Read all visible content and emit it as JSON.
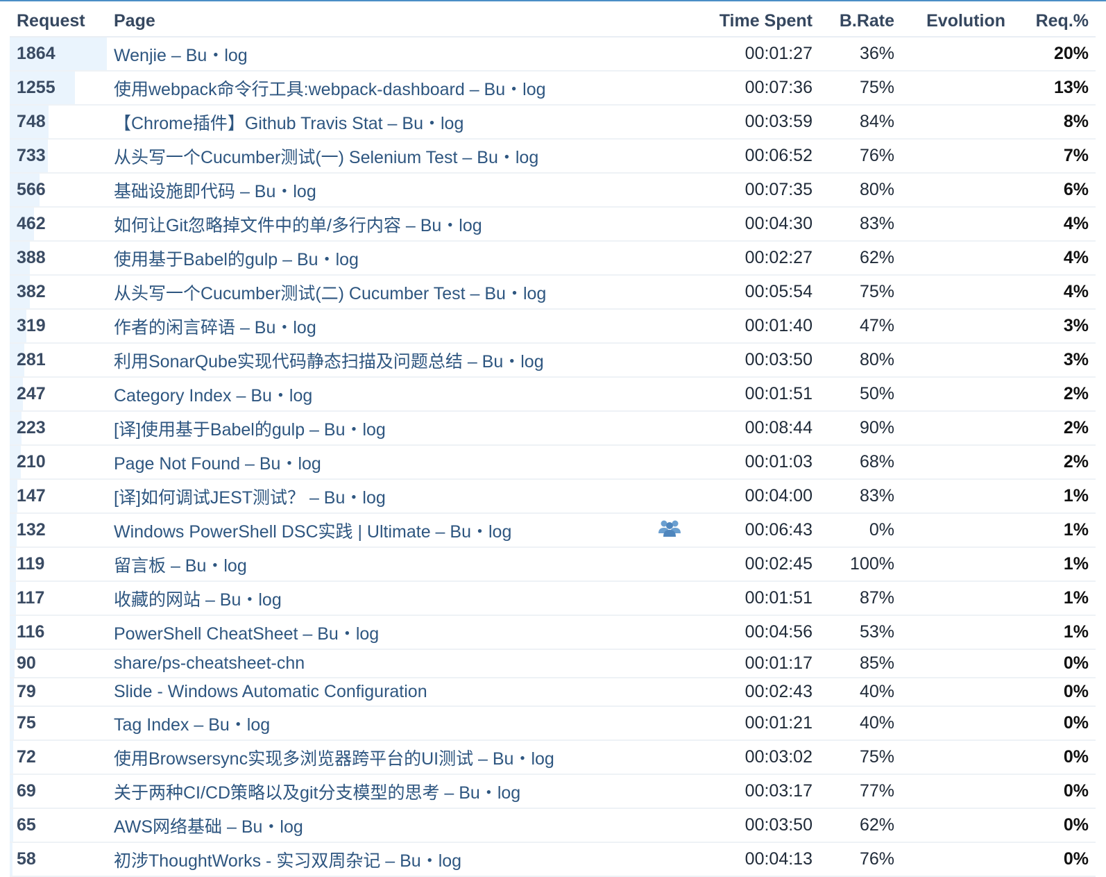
{
  "table": {
    "headers": {
      "request": "Request",
      "page": "Page",
      "time_spent": "Time Spent",
      "bounce_rate": "B.Rate",
      "evolution": "Evolution",
      "req_pct": "Req.%"
    },
    "colors": {
      "accent": "#4a8ec6",
      "request_bar": "#eaf4fd",
      "link": "#2e5680",
      "icon": "#6a9fd0"
    },
    "rows": [
      {
        "request": "1864",
        "bar_fraction": 1.0,
        "page": "Wenjie – Bu・log",
        "time": "00:01:27",
        "brate": "36%",
        "evolution": "",
        "req_pct": "20%"
      },
      {
        "request": "1255",
        "bar_fraction": 0.673,
        "page": "使用webpack命令行工具:webpack-dashboard – Bu・log",
        "time": "00:07:36",
        "brate": "75%",
        "evolution": "",
        "req_pct": "13%"
      },
      {
        "request": "748",
        "bar_fraction": 0.401,
        "page": "【Chrome插件】Github Travis Stat – Bu・log",
        "time": "00:03:59",
        "brate": "84%",
        "evolution": "",
        "req_pct": "8%"
      },
      {
        "request": "733",
        "bar_fraction": 0.393,
        "page": "从头写一个Cucumber测试(一) Selenium Test – Bu・log",
        "time": "00:06:52",
        "brate": "76%",
        "evolution": "",
        "req_pct": "7%"
      },
      {
        "request": "566",
        "bar_fraction": 0.304,
        "page": "基础设施即代码 – Bu・log",
        "time": "00:07:35",
        "brate": "80%",
        "evolution": "",
        "req_pct": "6%"
      },
      {
        "request": "462",
        "bar_fraction": 0.248,
        "page": "如何让Git忽略掉文件中的单/多行内容 – Bu・log",
        "time": "00:04:30",
        "brate": "83%",
        "evolution": "",
        "req_pct": "4%"
      },
      {
        "request": "388",
        "bar_fraction": 0.208,
        "page": "使用基于Babel的gulp – Bu・log",
        "time": "00:02:27",
        "brate": "62%",
        "evolution": "",
        "req_pct": "4%"
      },
      {
        "request": "382",
        "bar_fraction": 0.205,
        "page": "从头写一个Cucumber测试(二) Cucumber Test – Bu・log",
        "time": "00:05:54",
        "brate": "75%",
        "evolution": "",
        "req_pct": "4%"
      },
      {
        "request": "319",
        "bar_fraction": 0.171,
        "page": "作者的闲言碎语 – Bu・log",
        "time": "00:01:40",
        "brate": "47%",
        "evolution": "",
        "req_pct": "3%"
      },
      {
        "request": "281",
        "bar_fraction": 0.151,
        "page": "利用SonarQube实现代码静态扫描及问题总结 – Bu・log",
        "time": "00:03:50",
        "brate": "80%",
        "evolution": "",
        "req_pct": "3%"
      },
      {
        "request": "247",
        "bar_fraction": 0.133,
        "page": "Category Index – Bu・log",
        "time": "00:01:51",
        "brate": "50%",
        "evolution": "",
        "req_pct": "2%"
      },
      {
        "request": "223",
        "bar_fraction": 0.12,
        "page": "[译]使用基于Babel的gulp – Bu・log",
        "time": "00:08:44",
        "brate": "90%",
        "evolution": "",
        "req_pct": "2%"
      },
      {
        "request": "210",
        "bar_fraction": 0.113,
        "page": "Page Not Found – Bu・log",
        "time": "00:01:03",
        "brate": "68%",
        "evolution": "",
        "req_pct": "2%"
      },
      {
        "request": "147",
        "bar_fraction": 0.079,
        "page": "[译]如何调试JEST测试？ – Bu・log",
        "time": "00:04:00",
        "brate": "83%",
        "evolution": "",
        "req_pct": "1%"
      },
      {
        "request": "132",
        "bar_fraction": 0.071,
        "page": "Windows PowerShell DSC实践 | Ultimate – Bu・log",
        "time": "00:06:43",
        "brate": "0%",
        "evolution": "",
        "req_pct": "1%",
        "icon": "users-icon"
      },
      {
        "request": "119",
        "bar_fraction": 0.064,
        "page": "留言板 – Bu・log",
        "time": "00:02:45",
        "brate": "100%",
        "evolution": "",
        "req_pct": "1%"
      },
      {
        "request": "117",
        "bar_fraction": 0.063,
        "page": "收藏的网站 – Bu・log",
        "time": "00:01:51",
        "brate": "87%",
        "evolution": "",
        "req_pct": "1%"
      },
      {
        "request": "116",
        "bar_fraction": 0.062,
        "page": "PowerShell CheatSheet – Bu・log",
        "time": "00:04:56",
        "brate": "53%",
        "evolution": "",
        "req_pct": "1%"
      },
      {
        "request": "90",
        "bar_fraction": 0.048,
        "page": "share/ps-cheatsheet-chn",
        "time": "00:01:17",
        "brate": "85%",
        "evolution": "",
        "req_pct": "0%",
        "short": true
      },
      {
        "request": "79",
        "bar_fraction": 0.042,
        "page": "Slide - Windows Automatic Configuration",
        "time": "00:02:43",
        "brate": "40%",
        "evolution": "",
        "req_pct": "0%",
        "short": true
      },
      {
        "request": "75",
        "bar_fraction": 0.04,
        "page": "Tag Index – Bu・log",
        "time": "00:01:21",
        "brate": "40%",
        "evolution": "",
        "req_pct": "0%"
      },
      {
        "request": "72",
        "bar_fraction": 0.039,
        "page": "使用Browsersync实现多浏览器跨平台的UI测试 – Bu・log",
        "time": "00:03:02",
        "brate": "75%",
        "evolution": "",
        "req_pct": "0%"
      },
      {
        "request": "69",
        "bar_fraction": 0.037,
        "page": "关于两种CI/CD策略以及git分支模型的思考 – Bu・log",
        "time": "00:03:17",
        "brate": "77%",
        "evolution": "",
        "req_pct": "0%"
      },
      {
        "request": "65",
        "bar_fraction": 0.035,
        "page": "AWS网络基础 – Bu・log",
        "time": "00:03:50",
        "brate": "62%",
        "evolution": "",
        "req_pct": "0%"
      },
      {
        "request": "58",
        "bar_fraction": 0.031,
        "page": "初涉ThoughtWorks - 实习双周杂记 – Bu・log",
        "time": "00:04:13",
        "brate": "76%",
        "evolution": "",
        "req_pct": "0%"
      }
    ]
  }
}
